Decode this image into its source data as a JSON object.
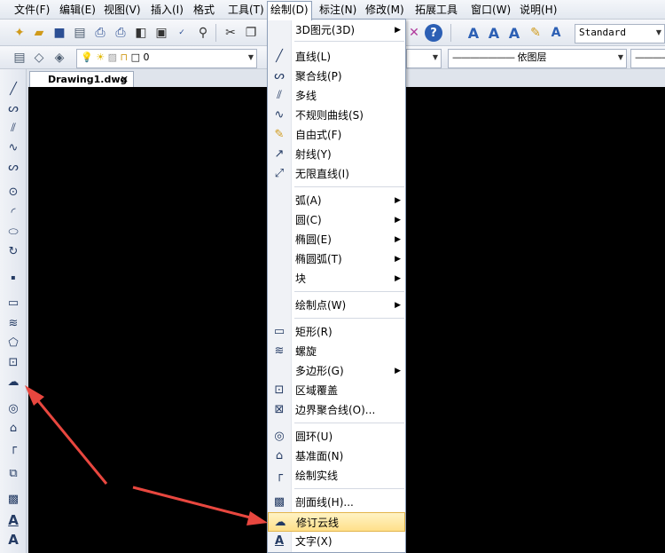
{
  "menubar": {
    "items": [
      "文件(F)",
      "编辑(E)",
      "视图(V)",
      "插入(I)",
      "格式",
      "工具(T)",
      "绘制(D)",
      "标注(N)",
      "修改(M)",
      "拓展工具",
      "窗口(W)",
      "说明(H)"
    ]
  },
  "toolbar": {
    "text_style": "Standard",
    "layer_value": "0",
    "linetype": "依图层"
  },
  "document": {
    "tab_title": "Drawing1.dwg",
    "close_glyph": "✕"
  },
  "draw_menu": {
    "items": [
      {
        "label": "3D图元(3D)",
        "icon": "",
        "submenu": true
      },
      {
        "label": "直线(L)",
        "icon": "line-icon",
        "submenu": false
      },
      {
        "label": "聚合线(P)",
        "icon": "polyline-icon",
        "submenu": false
      },
      {
        "label": "多线",
        "icon": "multiline-icon",
        "submenu": false
      },
      {
        "label": "不规则曲线(S)",
        "icon": "spline-icon",
        "submenu": false
      },
      {
        "label": "自由式(F)",
        "icon": "freehand-icon",
        "submenu": false
      },
      {
        "label": "射线(Y)",
        "icon": "ray-icon",
        "submenu": false
      },
      {
        "label": "无限直线(I)",
        "icon": "xline-icon",
        "submenu": false
      },
      {
        "label": "弧(A)",
        "icon": "",
        "submenu": true
      },
      {
        "label": "圆(C)",
        "icon": "",
        "submenu": true
      },
      {
        "label": "椭圆(E)",
        "icon": "",
        "submenu": true
      },
      {
        "label": "椭圆弧(T)",
        "icon": "",
        "submenu": true
      },
      {
        "label": "块",
        "icon": "",
        "submenu": true
      },
      {
        "label": "绘制点(W)",
        "icon": "",
        "submenu": true
      },
      {
        "label": "矩形(R)",
        "icon": "rectangle-icon",
        "submenu": false
      },
      {
        "label": "螺旋",
        "icon": "helix-icon",
        "submenu": false
      },
      {
        "label": "多边形(G)",
        "icon": "",
        "submenu": true
      },
      {
        "label": "区域覆盖",
        "icon": "wipeout-icon",
        "submenu": false
      },
      {
        "label": "边界聚合线(O)...",
        "icon": "boundary-icon",
        "submenu": false
      },
      {
        "label": "圆环(U)",
        "icon": "donut-icon",
        "submenu": false
      },
      {
        "label": "基准面(N)",
        "icon": "plane-icon",
        "submenu": false
      },
      {
        "label": "绘制实线",
        "icon": "solid-icon",
        "submenu": false
      },
      {
        "label": "剖面线(H)...",
        "icon": "hatch-icon",
        "submenu": false
      },
      {
        "label": "修订云线",
        "icon": "revcloud-icon",
        "submenu": false,
        "highlighted": true
      },
      {
        "label": "文字(X)",
        "icon": "text-icon",
        "submenu": false
      }
    ]
  },
  "colors": {
    "annotation_arrow": "#e8473f",
    "highlight": "#ffe08a",
    "canvas": "#000000"
  }
}
